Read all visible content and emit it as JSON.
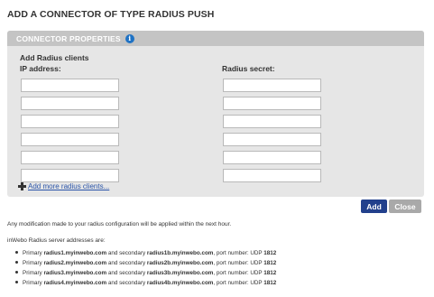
{
  "page": {
    "title": "ADD A CONNECTOR OF TYPE RADIUS PUSH"
  },
  "panel": {
    "header": "CONNECTOR PROPERTIES",
    "info_icon": "info-icon",
    "section_title": "Add Radius clients",
    "ip_label": "IP address:",
    "secret_label": "Radius secret:",
    "ip_values": [
      "",
      "",
      "",
      "",
      "",
      ""
    ],
    "secret_values": [
      "",
      "",
      "",
      "",
      "",
      ""
    ],
    "add_more_label": "Add more radius clients..."
  },
  "buttons": {
    "add": "Add",
    "close": "Close"
  },
  "colors": {
    "add_button": "#22408c",
    "close_button": "#a9a9a9",
    "panel_header": "#c4c4c4",
    "panel_body": "#e6e6e6",
    "link": "#2a54a8",
    "info_icon": "#1f72c4"
  },
  "info": {
    "notice": "Any modification made to your radius configuration will be applied within the next hour.",
    "servers_intro": "inWebo Radius server addresses are:",
    "servers": [
      {
        "prefix": "Primary ",
        "primary": "radius1.myinwebo.com",
        "middle": " and secondary ",
        "secondary": "radius1b.myinwebo.com",
        "suffix": ", port number: UDP ",
        "port": "1812"
      },
      {
        "prefix": "Primary ",
        "primary": "radius2.myinwebo.com",
        "middle": " and secondary ",
        "secondary": "radius2b.myinwebo.com",
        "suffix": ", port number: UDP ",
        "port": "1812"
      },
      {
        "prefix": "Primary ",
        "primary": "radius3.myinwebo.com",
        "middle": " and secondary ",
        "secondary": "radius3b.myinwebo.com",
        "suffix": ", port number: UDP ",
        "port": "1812"
      },
      {
        "prefix": "Primary ",
        "primary": "radius4.myinwebo.com",
        "middle": " and secondary ",
        "secondary": "radius4b.myinwebo.com",
        "suffix": ", port number: UDP ",
        "port": "1812"
      }
    ]
  }
}
